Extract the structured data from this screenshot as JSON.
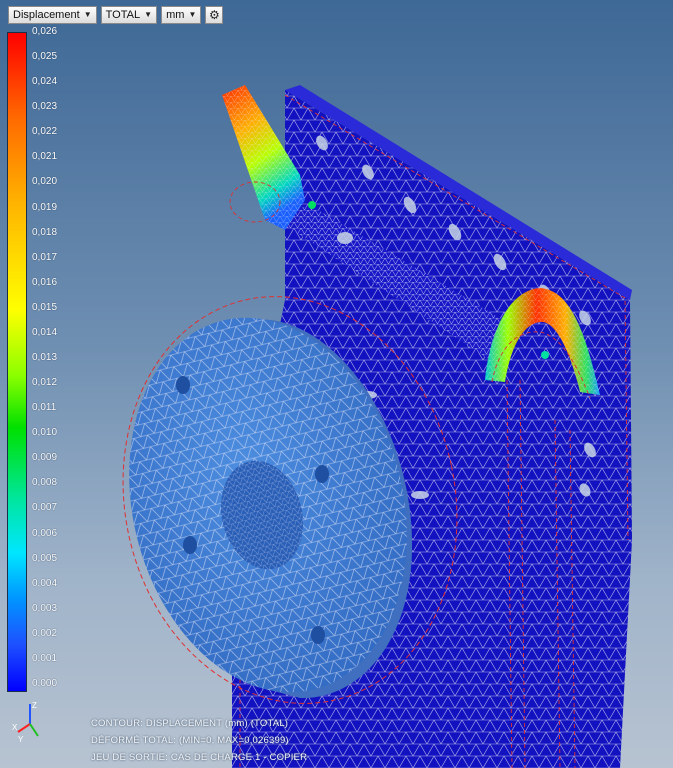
{
  "toolbar": {
    "result_type": "Displacement",
    "component": "TOTAL",
    "unit": "mm",
    "settings_icon": "gear-icon"
  },
  "legend": {
    "ticks": [
      "0,026",
      "0,025",
      "0,024",
      "0,023",
      "0,022",
      "0,021",
      "0,020",
      "0,019",
      "0,018",
      "0,017",
      "0,016",
      "0,015",
      "0,014",
      "0,013",
      "0,012",
      "0,011",
      "0,010",
      "0,009",
      "0,008",
      "0,007",
      "0,006",
      "0,005",
      "0,004",
      "0,003",
      "0,002",
      "0,001",
      "0,000"
    ],
    "max_color": "#ff0000",
    "min_color": "#0000ff"
  },
  "triad": {
    "x": "X",
    "y": "Y",
    "z": "Z"
  },
  "footer": {
    "line1": "CONTOUR: DISPLACEMENT (mm) (TOTAL)",
    "line2": "DÉFORMÉ TOTAL: (MIN=0, MAX=0,026399)",
    "line3": "JEU DE SORTIE: CAS DE CHARGE 1 - COPIER"
  },
  "colors": {
    "mesh_body": "#1414c8",
    "flange": "#3b7bd1",
    "mesh_line": "#e8e8f8",
    "undeformed_outline": "#e03030"
  }
}
